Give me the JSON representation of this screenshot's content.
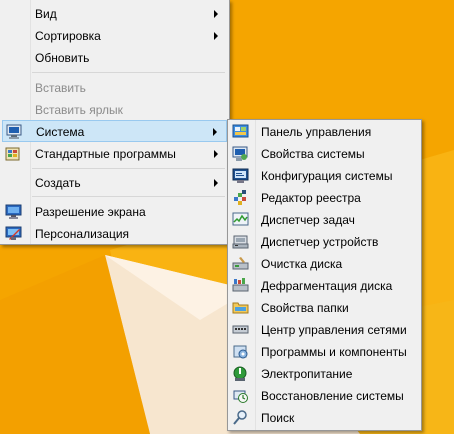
{
  "main_menu": {
    "items": [
      {
        "label": "Вид",
        "submenu": true
      },
      {
        "label": "Сортировка",
        "submenu": true
      },
      {
        "label": "Обновить"
      },
      {
        "label": "Вставить",
        "disabled": true
      },
      {
        "label": "Вставить ярлык",
        "disabled": true
      },
      {
        "label": "Система",
        "submenu": true,
        "highlighted": true,
        "icon": "system-icon"
      },
      {
        "label": "Стандартные программы",
        "submenu": true,
        "icon": "accessories-icon"
      },
      {
        "label": "Создать",
        "submenu": true
      },
      {
        "label": "Разрешение экрана",
        "icon": "screen-resolution-icon"
      },
      {
        "label": "Персонализация",
        "icon": "personalization-icon"
      }
    ]
  },
  "sub_menu": {
    "items": [
      {
        "label": "Панель управления",
        "icon": "control-panel-icon"
      },
      {
        "label": "Свойства системы",
        "icon": "system-properties-icon"
      },
      {
        "label": "Конфигурация системы",
        "icon": "system-config-icon"
      },
      {
        "label": "Редактор реестра",
        "icon": "registry-editor-icon"
      },
      {
        "label": "Диспетчер задач",
        "icon": "task-manager-icon"
      },
      {
        "label": "Диспетчер устройств",
        "icon": "device-manager-icon"
      },
      {
        "label": "Очистка диска",
        "icon": "disk-cleanup-icon"
      },
      {
        "label": "Дефрагментация диска",
        "icon": "defrag-icon"
      },
      {
        "label": "Свойства папки",
        "icon": "folder-options-icon"
      },
      {
        "label": "Центр управления сетями",
        "icon": "network-center-icon"
      },
      {
        "label": "Программы и компоненты",
        "icon": "programs-features-icon"
      },
      {
        "label": "Электропитание",
        "icon": "power-options-icon"
      },
      {
        "label": "Восстановление системы",
        "icon": "system-restore-icon"
      },
      {
        "label": "Поиск",
        "icon": "search-icon"
      }
    ]
  },
  "colors": {
    "desktop": "#f5a500",
    "menu_bg": "#f0f0f0",
    "highlight": "#cde6f7",
    "highlight_border": "#99c9ef"
  }
}
